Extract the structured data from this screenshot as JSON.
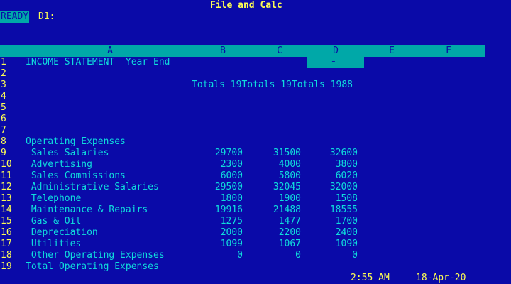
{
  "app_title": "File and Calc",
  "mode_indicator": "READY",
  "cell_reference": "D1:",
  "column_headers": [
    "A",
    "B",
    "C",
    "D",
    "E",
    "F"
  ],
  "row_numbers": [
    "1",
    "2",
    "3",
    "4",
    "5",
    "6",
    "7",
    "8",
    "9",
    "10",
    "11",
    "12",
    "13",
    "14",
    "15",
    "16",
    "17",
    "18",
    "19"
  ],
  "active_cell_content": "-",
  "sheet": {
    "row1_a": "INCOME STATEMENT  Year End",
    "row3_totals": "Totals 19Totals 19Totals 1988",
    "row8_a": "Operating Expenses",
    "row19_a": "Total Operating Expenses",
    "expenses": [
      {
        "label": " Sales Salaries",
        "b": "29700",
        "c": "31500",
        "d": "32600"
      },
      {
        "label": " Advertising",
        "b": "2300",
        "c": "4000",
        "d": "3800"
      },
      {
        "label": " Sales Commissions",
        "b": "6000",
        "c": "5800",
        "d": "6020"
      },
      {
        "label": " Administrative Salaries",
        "b": "29500",
        "c": "32045",
        "d": "32000"
      },
      {
        "label": " Telephone",
        "b": "1800",
        "c": "1900",
        "d": "1508"
      },
      {
        "label": " Maintenance & Repairs",
        "b": "19916",
        "c": "21488",
        "d": "18555"
      },
      {
        "label": " Gas & Oil",
        "b": "1275",
        "c": "1477",
        "d": "1700"
      },
      {
        "label": " Depreciation",
        "b": "2000",
        "c": "2200",
        "d": "2400"
      },
      {
        "label": " Utilities",
        "b": "1099",
        "c": "1067",
        "d": "1090"
      },
      {
        "label": " Other Operating Expenses",
        "b": "0",
        "c": "0",
        "d": "0"
      }
    ]
  },
  "status_bar": {
    "time": "2:55 AM",
    "date": "18-Apr-20"
  }
}
